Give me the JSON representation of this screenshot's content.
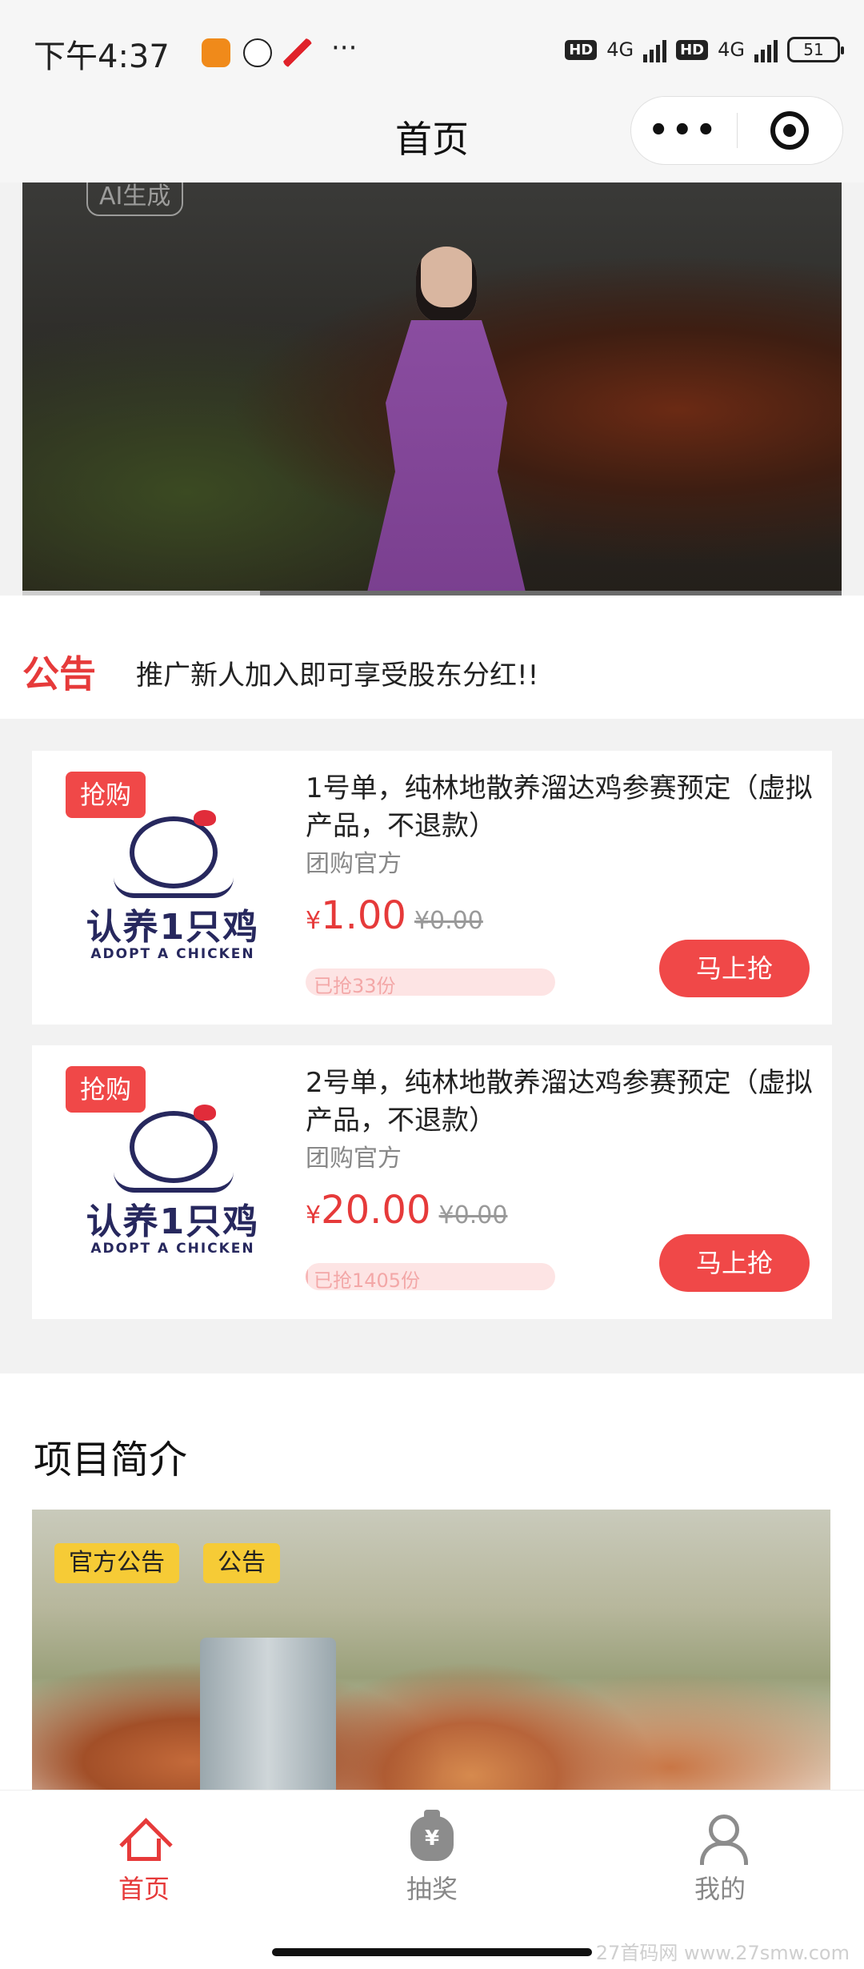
{
  "status_bar": {
    "time": "下午4:37",
    "hd1": "HD",
    "net1": "4G",
    "hd2": "HD",
    "net2": "4G",
    "battery": "51"
  },
  "nav": {
    "title": "首页",
    "more_label": "•••"
  },
  "video": {
    "ai_tag": "AI生成",
    "progress": 0.29
  },
  "notice": {
    "label": "公告",
    "text": "推广新人加入即可享受股东分红!!"
  },
  "products": [
    {
      "tag": "抢购",
      "logo_cn": "认养1只鸡",
      "logo_en": "ADOPT A CHICKEN",
      "name": "1号单，纯林地散养溜达鸡参赛预定（虚拟产品，不退款）",
      "shop": "团购官方",
      "currency": "¥",
      "price": "1.00",
      "old_price": "¥0.00",
      "sold": "已抢33份",
      "sold_ratio": 0.0,
      "buy_label": "马上抢"
    },
    {
      "tag": "抢购",
      "logo_cn": "认养1只鸡",
      "logo_en": "ADOPT A CHICKEN",
      "name": "2号单，纯林地散养溜达鸡参赛预定（虚拟产品，不退款）",
      "shop": "团购官方",
      "currency": "¥",
      "price": "20.00",
      "old_price": "¥0.00",
      "sold": "已抢1405份",
      "sold_ratio": 0.01,
      "buy_label": "马上抢"
    }
  ],
  "intro": {
    "heading": "项目简介",
    "chips": [
      "官方公告",
      "公告"
    ]
  },
  "tabbar": {
    "home": "首页",
    "lottery": "抽奖",
    "lottery_icon": "¥",
    "mine": "我的"
  },
  "watermark": "27首码网 www.27smw.com",
  "colors": {
    "accent": "#e63a3a",
    "button": "#f04848",
    "chip": "#f6cb36"
  }
}
